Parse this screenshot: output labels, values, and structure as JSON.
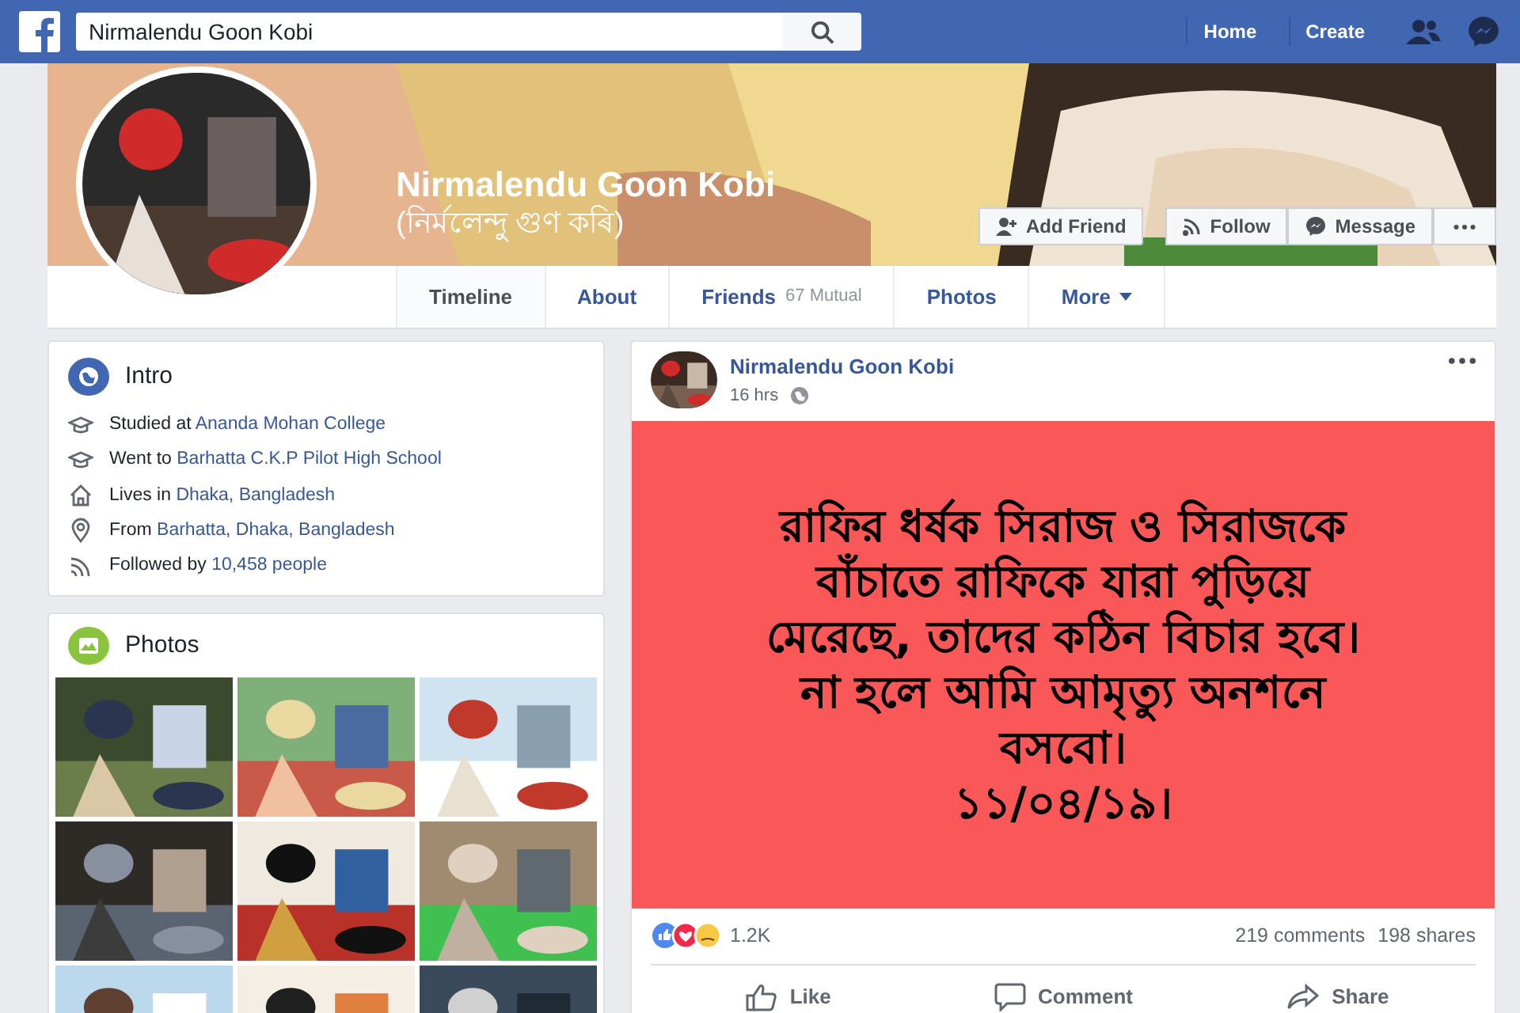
{
  "topbar": {
    "search": {
      "value": "Nirmalendu Goon Kobi"
    },
    "nav": [
      "Home",
      "Create"
    ]
  },
  "profile": {
    "name": "Nirmalendu Goon Kobi",
    "subtitle": "(নির্মলেন্দু গুণ কৰি)",
    "actions": [
      {
        "label": "Add Friend",
        "kind": "add-friend"
      },
      {
        "label": "Follow",
        "kind": "follow"
      },
      {
        "label": "Message",
        "kind": "message"
      }
    ]
  },
  "tabs": [
    {
      "label": "Timeline",
      "selected": true
    },
    {
      "label": "About",
      "selected": false
    },
    {
      "label": "Friends",
      "count": "67 Mutual",
      "selected": false
    },
    {
      "label": "Photos",
      "selected": false
    },
    {
      "label": "More",
      "selected": false,
      "dropdown": true
    }
  ],
  "intro": {
    "title": "Intro",
    "items": [
      {
        "kind": "education",
        "prefix": "Studied at ",
        "link": "Ananda Mohan College"
      },
      {
        "kind": "education",
        "prefix": "Went to ",
        "link": "Barhatta C.K.P Pilot High School"
      },
      {
        "kind": "home",
        "prefix": "Lives in ",
        "link": "Dhaka, Bangladesh"
      },
      {
        "kind": "place",
        "prefix": "From ",
        "link": "Barhatta, Dhaka, Bangladesh"
      },
      {
        "kind": "followers",
        "prefix": "Followed by ",
        "link": "10,458 people"
      }
    ]
  },
  "photos": {
    "title": "Photos"
  },
  "post": {
    "author": "Nirmalendu Goon Kobi",
    "time": "16 hrs",
    "text": "রাফির ধর্ষক সিরাজ ও সিরাজকে\nবাঁচাতে রাফিকে যারা পুড়িয়ে\nমেরেছে, তাদের কঠিন বিচার হবে।\nনা হলে আমি আমৃত্যু অনশনে\nবসবো।\n১১/০৪/১৯।",
    "reactions": "1.2K",
    "comments": "219 comments",
    "shares": "198 shares",
    "actions": [
      {
        "label": "Like",
        "kind": "like"
      },
      {
        "label": "Comment",
        "kind": "comment"
      },
      {
        "label": "Share",
        "kind": "share"
      }
    ]
  }
}
